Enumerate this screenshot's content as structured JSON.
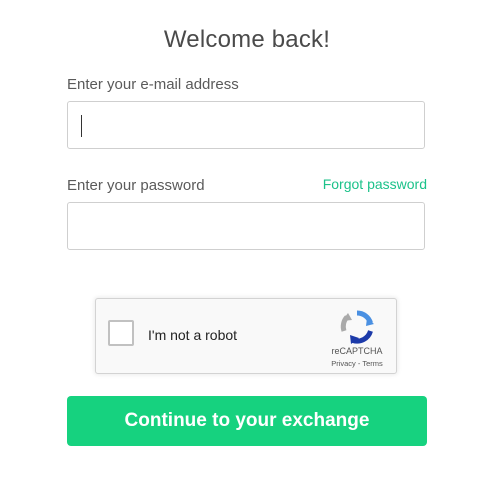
{
  "heading": "Welcome back!",
  "email": {
    "label": "Enter your e-mail address",
    "value": ""
  },
  "password": {
    "label": "Enter your password",
    "forgot_link": "Forgot password",
    "value": ""
  },
  "recaptcha": {
    "checkbox_label": "I'm not a robot",
    "brand": "reCAPTCHA",
    "privacy": "Privacy",
    "separator": " - ",
    "terms": "Terms",
    "logo_icon": "recaptcha-logo-icon"
  },
  "submit_label": "Continue to your exchange",
  "colors": {
    "accent": "#16d27f",
    "link": "#1cc28a"
  }
}
